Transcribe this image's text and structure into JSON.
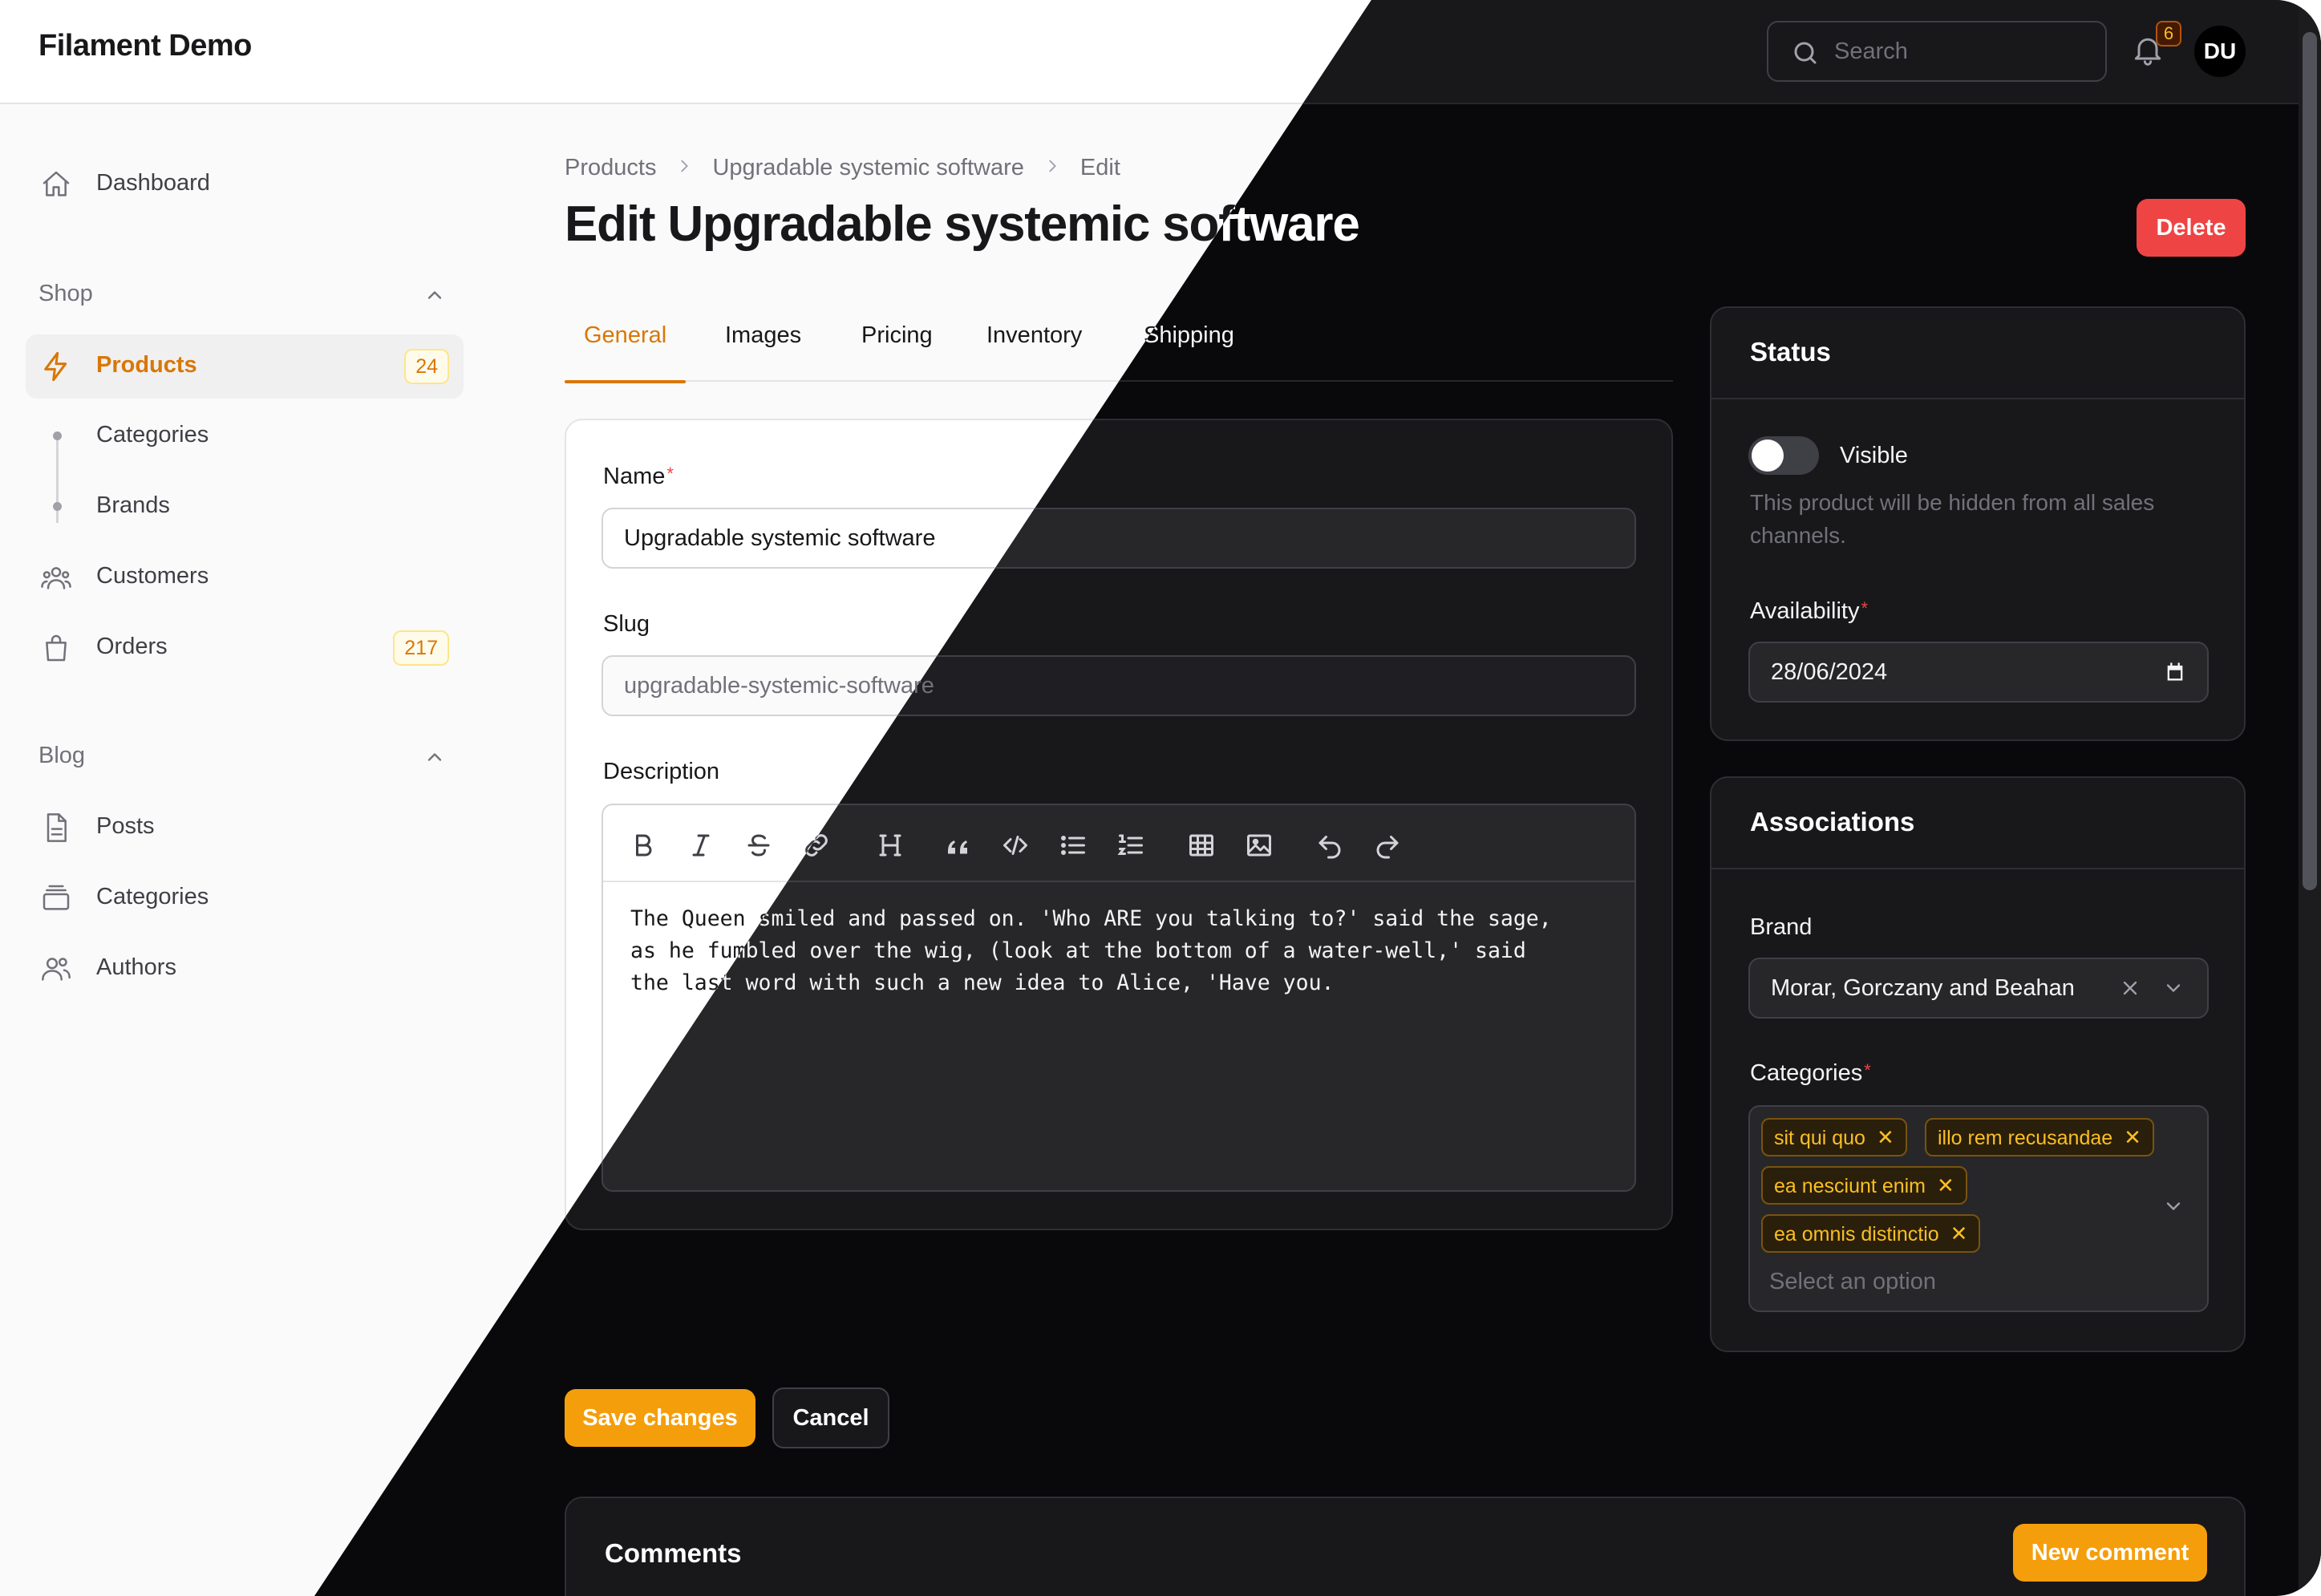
{
  "app": {
    "title": "Filament Demo"
  },
  "topbar": {
    "search_placeholder": "Search",
    "notification_count": "6",
    "user_initials": "DU"
  },
  "sidebar": {
    "dashboard": "Dashboard",
    "shop_label": "Shop",
    "products": "Products",
    "products_badge": "24",
    "categories": "Categories",
    "brands": "Brands",
    "customers": "Customers",
    "orders": "Orders",
    "orders_badge": "217",
    "blog_label": "Blog",
    "posts": "Posts",
    "blog_categories": "Categories",
    "authors": "Authors"
  },
  "breadcrumb": {
    "root": "Products",
    "record": "Upgradable systemic software",
    "current": "Edit"
  },
  "page": {
    "title": "Edit Upgradable systemic software",
    "delete_label": "Delete"
  },
  "tabs": {
    "general": "General",
    "images": "Images",
    "pricing": "Pricing",
    "inventory": "Inventory",
    "shipping": "Shipping"
  },
  "form": {
    "name_label": "Name",
    "name_value": "Upgradable systemic software",
    "slug_label": "Slug",
    "slug_value": "upgradable-systemic-software",
    "description_label": "Description",
    "description_lines": [
      "The Queen smiled and passed on. 'Who ARE you talking to?' said the sage,",
      "as he fumbled over the wig, (look at the bottom of a water-well,' said",
      "the last word with such a new idea to Alice, 'Have you."
    ],
    "save_label": "Save changes",
    "cancel_label": "Cancel"
  },
  "status_card": {
    "title": "Status",
    "visible_label": "Visible",
    "visible_on": false,
    "visible_helper": "This product will be hidden from all sales channels.",
    "availability_label": "Availability",
    "availability_value": "28/06/2024"
  },
  "associations_card": {
    "title": "Associations",
    "brand_label": "Brand",
    "brand_value": "Morar, Gorczany and Beahan",
    "categories_label": "Categories",
    "categories": [
      "sit qui quo",
      "illo rem recusandae",
      "ea nesciunt enim",
      "ea omnis distinctio"
    ],
    "categories_placeholder": "Select an option"
  },
  "comments": {
    "title": "Comments",
    "new_label": "New comment"
  },
  "colors": {
    "primary": "#f59e0b",
    "danger": "#ef4444",
    "primary_text": "#d97706"
  }
}
